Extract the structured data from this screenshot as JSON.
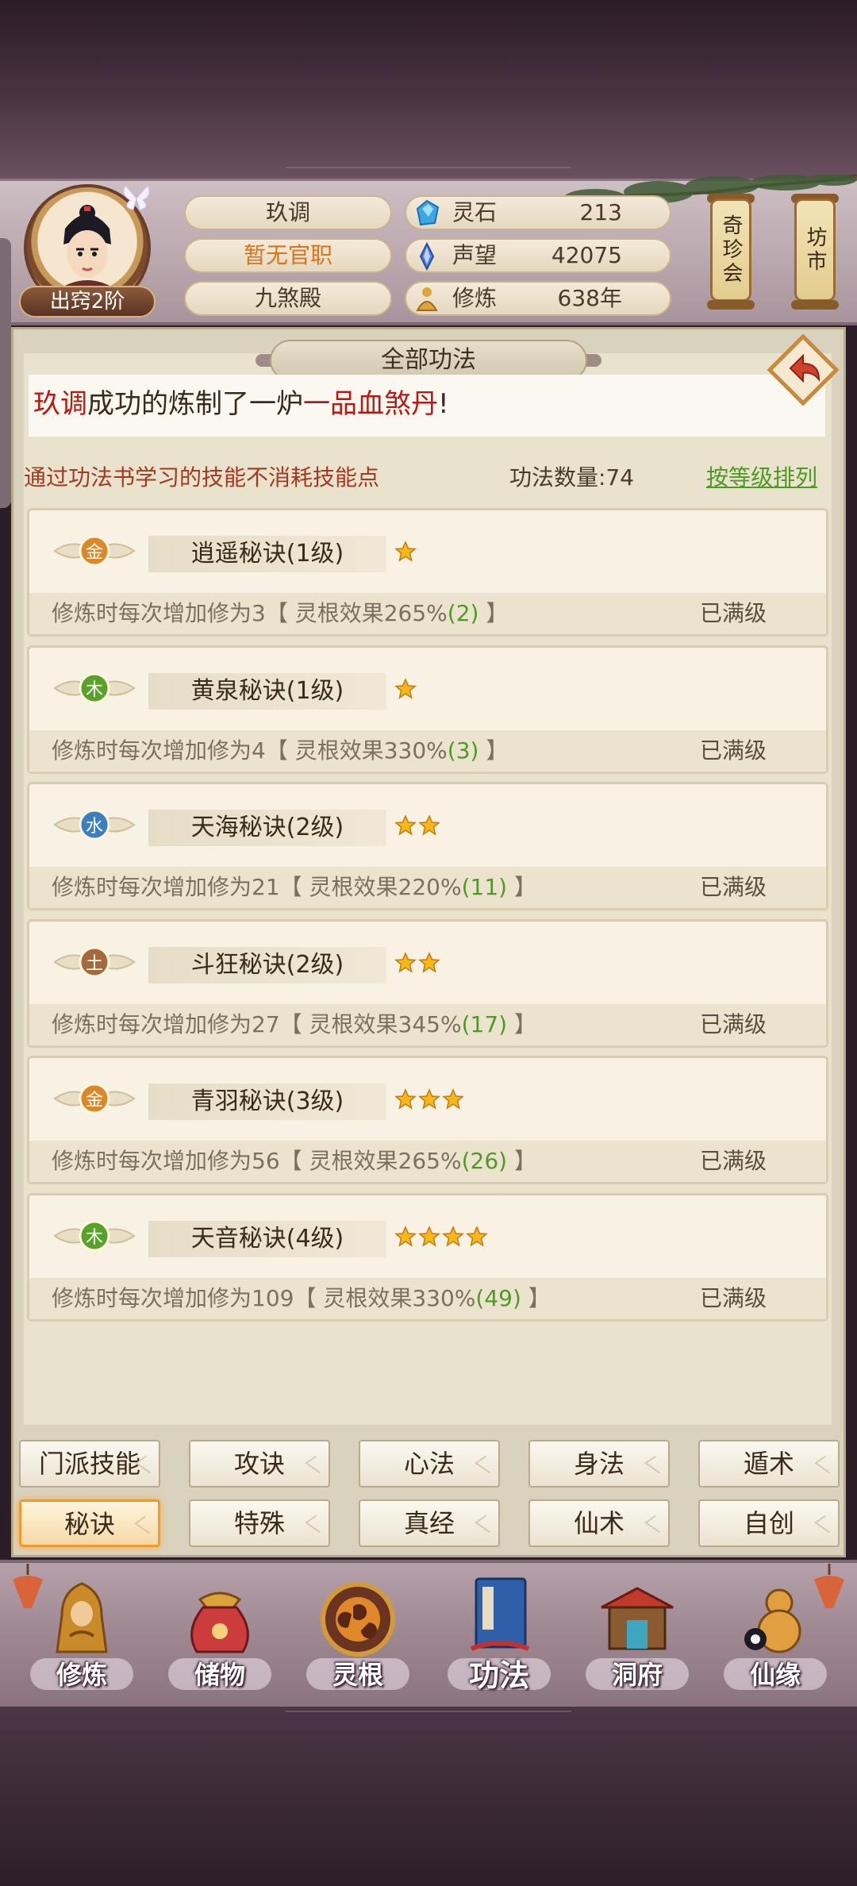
{
  "player": {
    "name": "玖调",
    "rank_badge": "出窍2阶",
    "official_title": "暂无官职",
    "sect": "九煞殿"
  },
  "resources": [
    {
      "icon": "spirit-stone-icon",
      "label": "灵石",
      "value": "213"
    },
    {
      "icon": "reputation-icon",
      "label": "声望",
      "value": "42075"
    },
    {
      "icon": "cultivation-icon",
      "label": "修炼",
      "value": "638年"
    }
  ],
  "side_buttons": {
    "treasure": "奇珍会",
    "market": "坊市"
  },
  "panel": {
    "title": "全部功法",
    "notice_name": "玖调",
    "notice_mid": "成功的炼制了一炉",
    "notice_item": "一品血煞丹",
    "notice_end": "!",
    "hint": "通过功法书学习的技能不消耗技能点",
    "count_label": "功法数量:74",
    "sort_label": "按等级排列"
  },
  "skills": [
    {
      "element": "金",
      "element_color": "#d9892a",
      "name": "逍遥秘诀(1级)",
      "stars": 1,
      "desc_pre": "修炼时每次增加修为3【 灵根效果265%",
      "desc_val": "(2)",
      "desc_post": " 】",
      "status": "已满级"
    },
    {
      "element": "木",
      "element_color": "#5aa12c",
      "name": "黄泉秘诀(1级)",
      "stars": 1,
      "desc_pre": "修炼时每次增加修为4【 灵根效果330%",
      "desc_val": "(3)",
      "desc_post": " 】",
      "status": "已满级"
    },
    {
      "element": "水",
      "element_color": "#3b7fc1",
      "name": "天海秘诀(2级)",
      "stars": 2,
      "desc_pre": "修炼时每次增加修为21【 灵根效果220%",
      "desc_val": "(11)",
      "desc_post": " 】",
      "status": "已满级"
    },
    {
      "element": "土",
      "element_color": "#a46a3a",
      "name": "斗狂秘诀(2级)",
      "stars": 2,
      "desc_pre": "修炼时每次增加修为27【 灵根效果345%",
      "desc_val": "(17)",
      "desc_post": " 】",
      "status": "已满级"
    },
    {
      "element": "金",
      "element_color": "#d9892a",
      "name": "青羽秘诀(3级)",
      "stars": 3,
      "desc_pre": "修炼时每次增加修为56【 灵根效果265%",
      "desc_val": "(26)",
      "desc_post": " 】",
      "status": "已满级"
    },
    {
      "element": "木",
      "element_color": "#5aa12c",
      "name": "天音秘诀(4级)",
      "stars": 4,
      "desc_pre": "修炼时每次增加修为109【 灵根效果330%",
      "desc_val": "(49)",
      "desc_post": " 】",
      "status": "已满级"
    }
  ],
  "filters": [
    "门派技能",
    "攻诀",
    "心法",
    "身法",
    "遁术",
    "秘诀",
    "特殊",
    "真经",
    "仙术",
    "自创"
  ],
  "active_filter_index": 5,
  "nav": [
    "修炼",
    "储物",
    "灵根",
    "功法",
    "洞府",
    "仙缘"
  ],
  "active_nav_index": 3
}
